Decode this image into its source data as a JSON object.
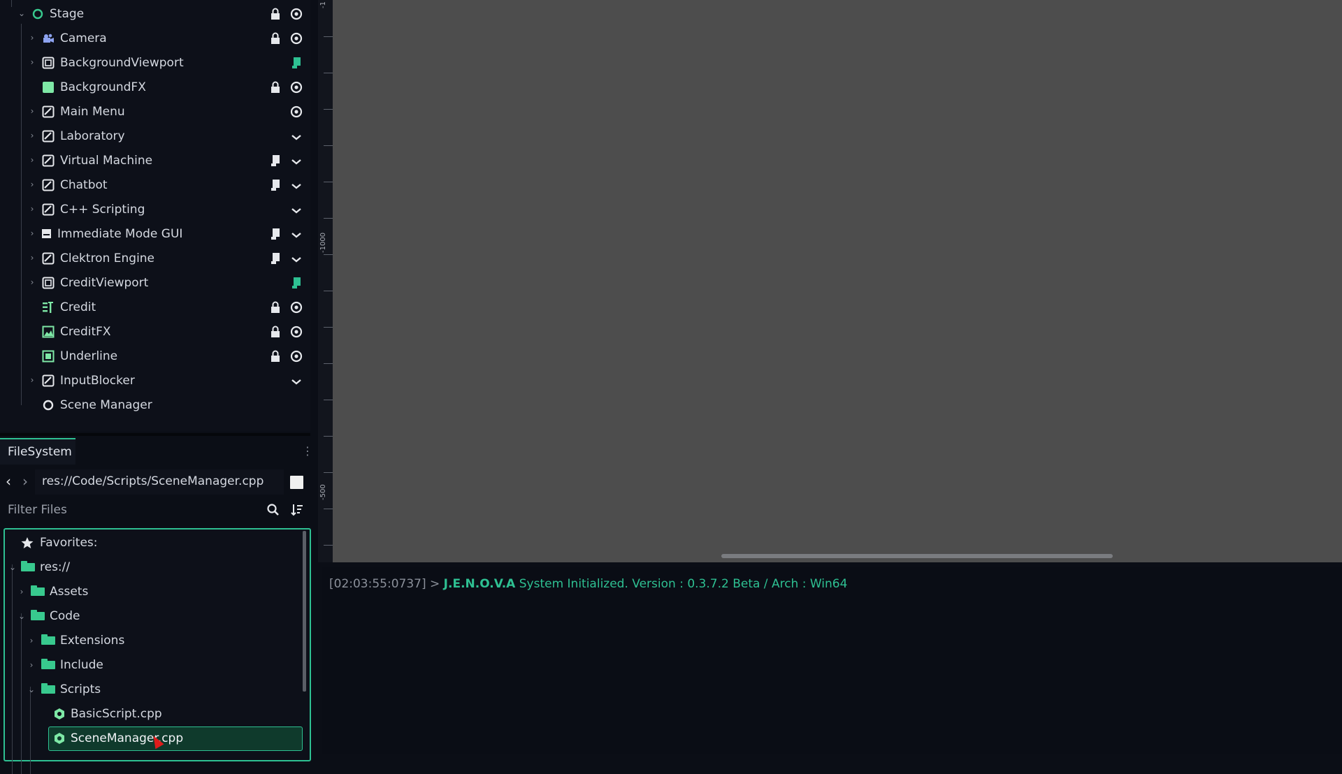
{
  "scene_tree": {
    "nodes": [
      {
        "label": "Stage",
        "icon": "node-icon",
        "controls": [
          "lock-icon",
          "eye-icon"
        ]
      },
      {
        "label": "Camera",
        "icon": "camera-icon",
        "controls": [
          "lock-icon",
          "eye-icon"
        ]
      },
      {
        "label": "BackgroundViewport",
        "icon": "viewport-icon",
        "controls": [
          "script-icon"
        ]
      },
      {
        "label": "BackgroundFX",
        "icon": "color-rect-icon",
        "controls": [
          "lock-icon",
          "eye-icon"
        ]
      },
      {
        "label": "Main Menu",
        "icon": "control-icon",
        "controls": [
          "eye-icon"
        ]
      },
      {
        "label": "Laboratory",
        "icon": "control-icon",
        "controls": [
          "chevron-down-icon"
        ]
      },
      {
        "label": "Virtual Machine",
        "icon": "control-icon",
        "controls": [
          "script-icon",
          "chevron-down-icon"
        ]
      },
      {
        "label": "Chatbot",
        "icon": "control-icon",
        "controls": [
          "script-icon",
          "chevron-down-icon"
        ]
      },
      {
        "label": "C++ Scripting",
        "icon": "control-icon",
        "controls": [
          "chevron-down-icon"
        ]
      },
      {
        "label": "Immediate Mode GUI",
        "icon": "panel-icon",
        "controls": [
          "script-icon",
          "chevron-down-icon"
        ]
      },
      {
        "label": "Clektron Engine",
        "icon": "control-icon",
        "controls": [
          "script-icon",
          "chevron-down-icon"
        ]
      },
      {
        "label": "CreditViewport",
        "icon": "viewport-icon",
        "controls": [
          "script-icon"
        ]
      },
      {
        "label": "Credit",
        "icon": "label-icon",
        "controls": [
          "lock-icon",
          "eye-icon"
        ]
      },
      {
        "label": "CreditFX",
        "icon": "texture-icon",
        "controls": [
          "lock-icon",
          "eye-icon"
        ]
      },
      {
        "label": "Underline",
        "icon": "texture-icon",
        "controls": [
          "lock-icon",
          "eye-icon"
        ]
      },
      {
        "label": "InputBlocker",
        "icon": "control-icon",
        "controls": [
          "chevron-down-icon"
        ]
      },
      {
        "label": "Scene Manager",
        "icon": "node-icon",
        "controls": []
      }
    ]
  },
  "viewport": {
    "ruler_labels": [
      "-1",
      "-1000",
      "-500"
    ]
  },
  "output": {
    "timestamp": "[02:03:55:0737]",
    "prompt": ">",
    "app_name": "J.E.N.O.V.A",
    "message": "System Initialized. Version : 0.3.7.2 Beta / Arch : Win64"
  },
  "filesystem": {
    "tab_label": "FileSystem",
    "path": "res://Code/Scripts/SceneManager.cpp",
    "filter_placeholder": "Filter Files",
    "favorites_label": "Favorites:",
    "items": [
      {
        "label": "res://",
        "kind": "folder"
      },
      {
        "label": "Assets",
        "kind": "folder"
      },
      {
        "label": "Code",
        "kind": "folder"
      },
      {
        "label": "Extensions",
        "kind": "folder"
      },
      {
        "label": "Include",
        "kind": "folder"
      },
      {
        "label": "Scripts",
        "kind": "folder"
      },
      {
        "label": "BasicScript.cpp",
        "kind": "file"
      },
      {
        "label": "SceneManager.cpp",
        "kind": "file",
        "selected": true
      }
    ]
  },
  "colors": {
    "accent": "#2ec092",
    "viewport_bg": "#4d4d4d",
    "log_text": "#2ec092",
    "log_timestamp": "#8b909a"
  }
}
